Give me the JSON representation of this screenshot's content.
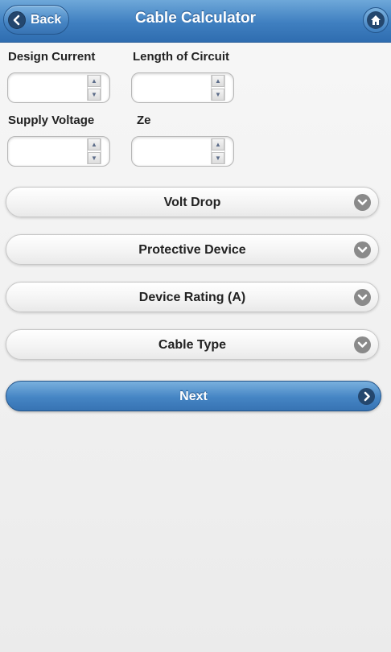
{
  "header": {
    "back_label": "Back",
    "title": "Cable Calculator"
  },
  "fields": {
    "design_current": {
      "label": "Design Current",
      "value": ""
    },
    "length_of_circuit": {
      "label": "Length of Circuit",
      "value": ""
    },
    "supply_voltage": {
      "label": "Supply Voltage",
      "value": ""
    },
    "ze": {
      "label": "Ze",
      "value": ""
    }
  },
  "selects": {
    "volt_drop": "Volt Drop",
    "protective_device": "Protective Device",
    "device_rating": "Device Rating (A)",
    "cable_type": "Cable Type"
  },
  "actions": {
    "next_label": "Next"
  },
  "colors": {
    "header_blue": "#3f7fc0",
    "button_blue": "#4585c4",
    "chevron_gray": "#8a8a8a"
  },
  "icons": {
    "back": "chevron-left-icon",
    "home": "home-icon",
    "select": "chevron-down-icon",
    "next": "chevron-right-icon"
  }
}
